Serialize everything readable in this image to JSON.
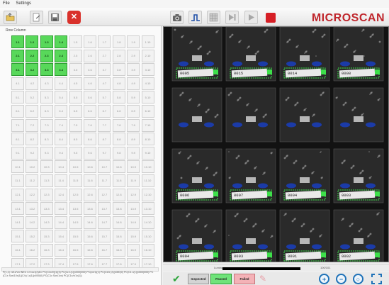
{
  "menu": [
    "File",
    "Settings"
  ],
  "brand": "MICROSCAN",
  "grid": {
    "header": "Row  Column",
    "cells": [
      [
        "1.1",
        "1.2",
        "1.3",
        "1.4",
        "1.5",
        "1.6",
        "1.7",
        "1.8",
        "1.9",
        "1.10"
      ],
      [
        "2.1",
        "2.2",
        "2.3",
        "2.4",
        "2.5",
        "2.6",
        "2.7",
        "2.8",
        "2.9",
        "2.10"
      ],
      [
        "3.1",
        "3.2",
        "3.3",
        "3.4",
        "3.5",
        "3.6",
        "3.7",
        "3.8",
        "3.9",
        "3.10"
      ],
      [
        "4.1",
        "4.2",
        "4.3",
        "4.4",
        "4.5",
        "4.6",
        "4.7",
        "4.8",
        "4.9",
        "4.10"
      ],
      [
        "5.1",
        "5.2",
        "5.3",
        "5.4",
        "5.5",
        "5.6",
        "5.7",
        "5.8",
        "5.9",
        "5.10"
      ],
      [
        "6.1",
        "6.2",
        "6.3",
        "6.4",
        "6.5",
        "6.6",
        "6.7",
        "6.8",
        "6.9",
        "6.10"
      ],
      [
        "7.1",
        "7.2",
        "7.3",
        "7.4",
        "7.5",
        "7.6",
        "7.7",
        "7.8",
        "7.9",
        "7.10"
      ],
      [
        "8.1",
        "8.2",
        "8.3",
        "8.4",
        "8.5",
        "8.6",
        "8.7",
        "8.8",
        "8.9",
        "8.10"
      ],
      [
        "9.1",
        "9.2",
        "9.3",
        "9.4",
        "9.5",
        "9.6",
        "9.7",
        "9.8",
        "9.9",
        "9.10"
      ],
      [
        "10.1",
        "10.2",
        "10.3",
        "10.4",
        "10.5",
        "10.6",
        "10.7",
        "10.8",
        "10.9",
        "10.10"
      ],
      [
        "11.1",
        "11.2",
        "11.3",
        "11.4",
        "11.5",
        "11.6",
        "11.7",
        "11.8",
        "11.9",
        "11.10"
      ],
      [
        "12.1",
        "12.2",
        "12.3",
        "12.4",
        "12.5",
        "12.6",
        "12.7",
        "12.8",
        "12.9",
        "12.10"
      ],
      [
        "13.1",
        "13.2",
        "13.3",
        "13.4",
        "13.5",
        "13.6",
        "13.7",
        "13.8",
        "13.9",
        "13.10"
      ],
      [
        "14.1",
        "14.2",
        "14.3",
        "14.4",
        "14.5",
        "14.6",
        "14.7",
        "14.8",
        "14.9",
        "14.10"
      ],
      [
        "15.1",
        "15.2",
        "15.3",
        "15.4",
        "15.5",
        "15.6",
        "15.7",
        "15.8",
        "15.9",
        "15.10"
      ],
      [
        "16.1",
        "16.2",
        "16.3",
        "16.4",
        "16.5",
        "16.6",
        "16.7",
        "16.8",
        "16.9",
        "16.10"
      ],
      [
        "17.1",
        "17.2",
        "17.3",
        "17.4",
        "17.5",
        "17.6",
        "17.7",
        "17.8",
        "17.9",
        "17.10"
      ]
    ],
    "passed": [
      "1.1",
      "1.2",
      "1.3",
      "1.4",
      "2.1",
      "2.2",
      "2.3",
      "2.4",
      "3.1",
      "3.2",
      "3.3",
      "3.4"
    ]
  },
  "log_text": "P(1,1): 4/11/Vu INEC 4.5 cu1(2)4C PC(C1x/0)(1)(3) PC(1c 1(1)(x000)000) PC(cx/1)(1) PC(Cx/x (2)(x000)0( PC(C1 c(1)(x000)000) PC(C1x Sos/10x(1)(C/c) 1c(1)(x000)0( PC(C1c Sos/1xx) PC(C1x/x/1x(1))",
  "viewer": {
    "labels": [
      "0005",
      "0015",
      "0014",
      "0008",
      "0006",
      "0007",
      "0004",
      "0003",
      "0004",
      "0003",
      "0001",
      "0002"
    ]
  },
  "slider": {
    "left_label": "Luminance",
    "right_label": "100/101"
  },
  "bottom": {
    "inspected_label": "Inspected",
    "passed_label": "Passed",
    "failed_label": "Failed"
  },
  "colors": {
    "pass": "#58d85a",
    "brand": "#c0272d",
    "stop": "#d61f26",
    "zoom": "#1f72b8"
  },
  "icons": {
    "toolbar_left": [
      "open-folder-icon",
      "export-icon",
      "save-icon",
      "close-icon"
    ],
    "toolbar_center": [
      "camera-icon",
      "trigger-signal-icon",
      "grid-layout-icon",
      "step-icon",
      "play-icon",
      "stop-icon"
    ],
    "bottom": [
      "checkmark-icon",
      "erase-icon",
      "zoom-in-icon",
      "zoom-out-icon",
      "zoom-fit-icon",
      "fullscreen-icon"
    ]
  }
}
